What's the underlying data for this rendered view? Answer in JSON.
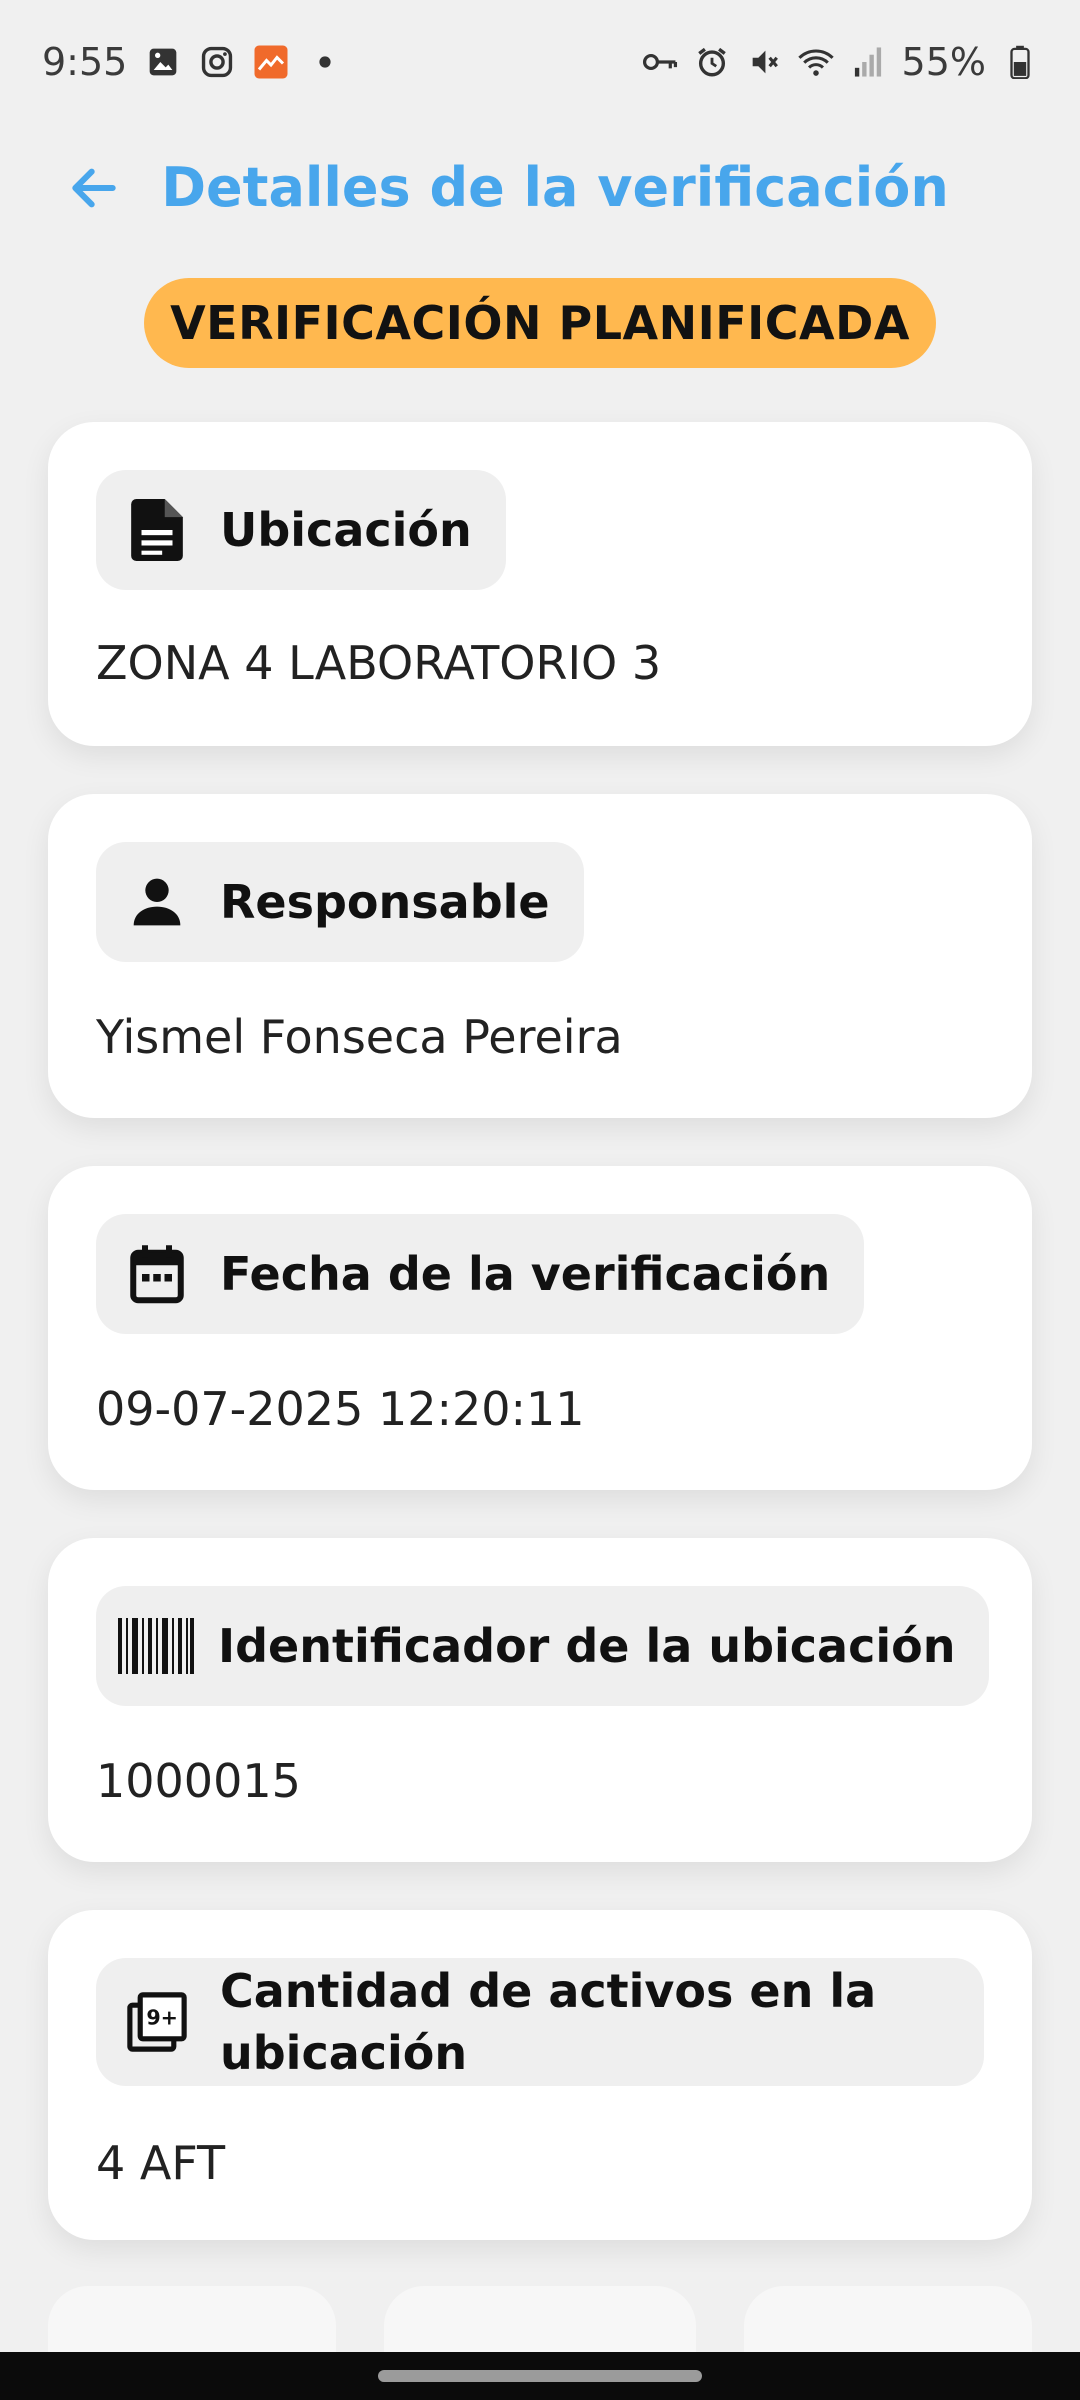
{
  "status_bar": {
    "time": "9:55",
    "battery": "55%",
    "icons_left": [
      "gallery-icon",
      "instagram-icon",
      "app-notification-icon",
      "dot-icon"
    ],
    "icons_right": [
      "vpn-key-icon",
      "alarm-icon",
      "mute-icon",
      "wifi-icon",
      "signal-icon",
      "battery-icon"
    ]
  },
  "header": {
    "title": "Detalles de la verificación",
    "accent_color": "#48a6ec"
  },
  "status_badge": {
    "label": "VERIFICACIÓN PLANIFICADA",
    "color": "#ffb84f"
  },
  "cards": [
    {
      "label": "Ubicación",
      "icon": "document-icon",
      "value": "ZONA 4 LABORATORIO 3"
    },
    {
      "label": "Responsable",
      "icon": "person-icon",
      "value": "Yismel Fonseca Pereira"
    },
    {
      "label": "Fecha de la verificación",
      "icon": "calendar-icon",
      "value": "09-07-2025 12:20:11"
    },
    {
      "label": "Identificador de la ubicación",
      "icon": "barcode-icon",
      "value": "1000015"
    },
    {
      "label": "Cantidad de activos en la ubicación",
      "label_line1": "Cantidad de activos en la",
      "label_line2": "ubicación",
      "icon": "nine-plus-icon",
      "value": "4 AFT"
    }
  ]
}
